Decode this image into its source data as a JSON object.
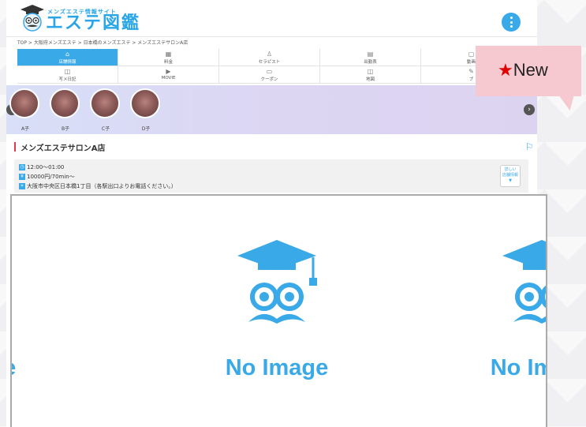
{
  "header": {
    "logo_tagline": "メンズエステ情報サイト",
    "logo_title": "エステ図鑑"
  },
  "breadcrumb": "TOP > 大阪府メンズエステ > 日本橋のメンズエステ > メンズエステサロンA店",
  "shop_nav": [
    {
      "label": "店舗情報",
      "icon": "⌂",
      "active": true
    },
    {
      "label": "料金",
      "icon": "▦",
      "active": false
    },
    {
      "label": "セラピスト",
      "icon": "♙",
      "active": false
    },
    {
      "label": "出勤表",
      "icon": "▤",
      "active": false
    },
    {
      "label": "動画",
      "icon": "▢",
      "active": false
    },
    {
      "label": "写メ日記",
      "icon": "◫",
      "active": false
    },
    {
      "label": "MOVIE",
      "icon": "▶",
      "active": false
    },
    {
      "label": "クーポン",
      "icon": "▭",
      "active": false
    },
    {
      "label": "地図",
      "icon": "◫",
      "active": false
    },
    {
      "label": "ブ",
      "icon": "✎",
      "active": false
    }
  ],
  "therapists": [
    {
      "name": "A子"
    },
    {
      "name": "B子"
    },
    {
      "name": "C子"
    },
    {
      "name": "D子"
    }
  ],
  "shop": {
    "title": "メンズエステサロンA店",
    "hours": "12:00～01:00",
    "price": "10000円/70min～",
    "address": "大阪市中央区日本橋1丁目（各駅出口よりお電話ください。）",
    "detail_button_line1": "詳しい",
    "detail_button_line2": "店舗情報",
    "detail_button_line3": "▼"
  },
  "gallery": {
    "slides": [
      "No Image",
      "No Image",
      "No Image"
    ],
    "dot_count": 4,
    "active_dot": 0
  },
  "badge": {
    "star": "★",
    "text": "New"
  },
  "colors": {
    "accent_blue": "#3aa9e8",
    "title_accent_red": "#e03a4b",
    "badge_pink": "#f5c9cf",
    "badge_star_red": "#e00000"
  }
}
